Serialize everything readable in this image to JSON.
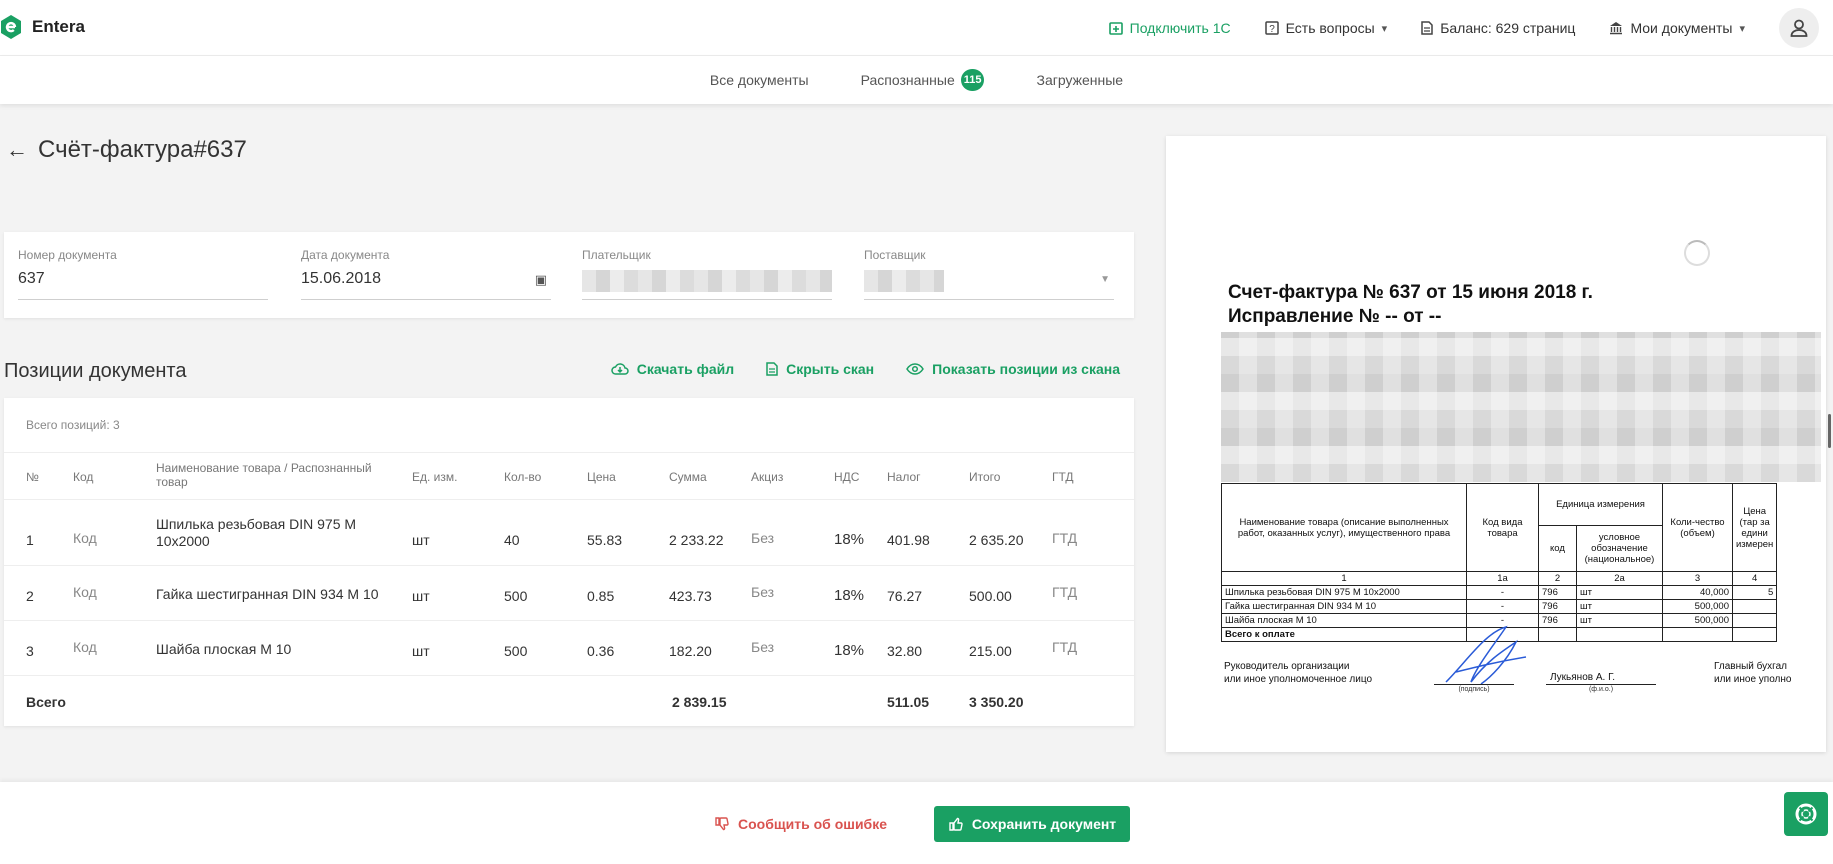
{
  "brand": {
    "name": "Entera",
    "color": "#1aa063"
  },
  "topnav": {
    "connect_1c": "Подключить 1С",
    "questions": "Есть вопросы",
    "balance": "Баланс: 629 страниц",
    "my_docs": "Мои документы"
  },
  "subnav": {
    "all": "Все документы",
    "recognized": "Распознанные",
    "recognized_count": "115",
    "uploaded": "Загруженные"
  },
  "doc": {
    "title": "Счёт-фактура#637"
  },
  "form": {
    "number_label": "Номер документа",
    "number_value": "637",
    "date_label": "Дата документа",
    "date_value": "15.06.2018",
    "payer_label": "Плательщик",
    "supplier_label": "Поставщик"
  },
  "positions": {
    "title": "Позиции документа",
    "download": "Скачать файл",
    "hide_scan": "Скрыть скан",
    "show_from_scan": "Показать позиции из скана",
    "total_count": "Всего позиций: 3",
    "headers": [
      "№",
      "Код",
      "Наименование товара / Распознанный товар",
      "Ед. изм.",
      "Кол-во",
      "Цена",
      "Сумма",
      "Акциз",
      "НДС",
      "Налог",
      "Итого",
      "ГТД"
    ],
    "rows": [
      {
        "n": "1",
        "code": "Код",
        "name": "Шпилька резьбовая DIN 975 М 10х2000",
        "unit": "шт",
        "qty": "40",
        "price": "55.83",
        "sum": "2 233.22",
        "excise": "Без",
        "vat": "18%",
        "tax": "401.98",
        "total": "2 635.20",
        "gtd": "ГТД"
      },
      {
        "n": "2",
        "code": "Код",
        "name": "Гайка шестигранная DIN 934 М 10",
        "unit": "шт",
        "qty": "500",
        "price": "0.85",
        "sum": "423.73",
        "excise": "Без",
        "vat": "18%",
        "tax": "76.27",
        "total": "500.00",
        "gtd": "ГТД"
      },
      {
        "n": "3",
        "code": "Код",
        "name": "Шайба плоская М 10",
        "unit": "шт",
        "qty": "500",
        "price": "0.36",
        "sum": "182.20",
        "excise": "Без",
        "vat": "18%",
        "tax": "32.80",
        "total": "215.00",
        "gtd": "ГТД"
      }
    ],
    "summary": {
      "label": "Всего",
      "sum": "2 839.15",
      "tax": "511.05",
      "total": "3 350.20"
    }
  },
  "scan": {
    "heading1": "Счет-фактура № 637 от 15 июня 2018 г.",
    "heading2": "Исправление № -- от --",
    "col_name": "Наименование товара (описание выполненных работ, оказанных услуг), имущественного права",
    "col_code": "Код вида товара",
    "col_unit": "Единица измерения",
    "col_unit_code": "код",
    "col_unit_name": "условное обозначение (национальное)",
    "col_qty": "Коли-чество (объем)",
    "col_price": "Цена (тар за едини измерен",
    "num_1": "1",
    "num_1a": "1а",
    "num_2": "2",
    "num_2a": "2а",
    "num_3": "3",
    "num_4": "4",
    "r1_name": "Шпилька резьбовая DIN 975 М 10х2000",
    "r1_qty": "40,000",
    "r1_price": "5",
    "r2_name": "Гайка шестигранная DIN 934 М 10",
    "r2_qty": "500,000",
    "r3_name": "Шайба плоская М 10",
    "r3_qty": "500,000",
    "dash": "-",
    "okei": "796",
    "unit": "шт",
    "total_label": "Всего к оплате",
    "head_org_1": "Руководитель организации",
    "head_org_2": "или иное уполномоченное лицо",
    "signer": "Лукьянов А. Г.",
    "sig_caption": "(подпись)",
    "fio_caption": "(ф.и.о.)",
    "chief_acc_1": "Главный бухгал",
    "chief_acc_2": "или иное уполно"
  },
  "bottom": {
    "report": "Сообщить об ошибке",
    "save": "Сохранить документ"
  }
}
